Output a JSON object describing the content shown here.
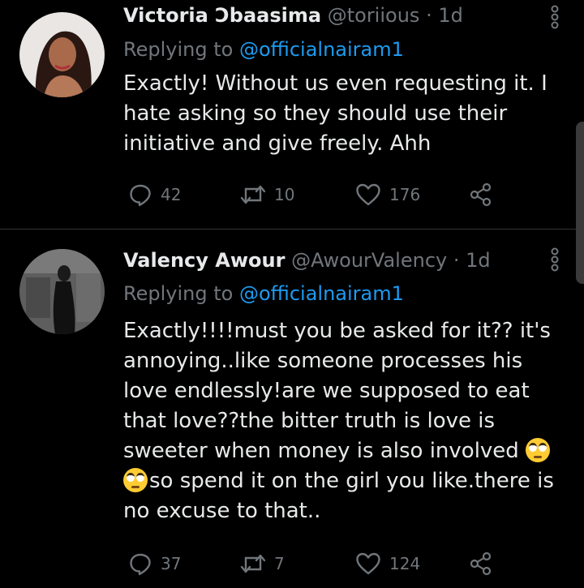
{
  "tweets": [
    {
      "name": "Victoria Ɔbaasima",
      "handle": "@toriious",
      "dot": "·",
      "time": "1d",
      "replying_prefix": "Replying to ",
      "replying_to": "@officialnairam1",
      "text": "Exactly! Without us even requesting it. I hate asking so they should use their initiative and give freely. Ahh",
      "replies": "42",
      "retweets": "10",
      "likes": "176"
    },
    {
      "name": "Valency Awour",
      "handle": "@AwourValency",
      "dot": "·",
      "time": "1d",
      "replying_prefix": "Replying to ",
      "replying_to": "@officialnairam1",
      "text_before_emoji": "Exactly!!!!must you be asked for it?? it's annoying..like someone processes his love endlessly!are we supposed to eat that love??the bitter truth is love is sweeter when money is also involved ",
      "emoji": "face-with-rolling-eyes",
      "text_after_emoji": "so spend it on the girl you like.there is no excuse to that..",
      "replies": "37",
      "retweets": "7",
      "likes": "124"
    }
  ],
  "colors": {
    "background": "#000000",
    "text": "#e7e9ea",
    "secondary": "#71767b",
    "link": "#1d9bf0",
    "divider": "#2f3336"
  },
  "icons": {
    "reply": "reply-icon",
    "retweet": "retweet-icon",
    "like": "heart-icon",
    "share": "share-icon",
    "more": "more-vertical-icon"
  }
}
